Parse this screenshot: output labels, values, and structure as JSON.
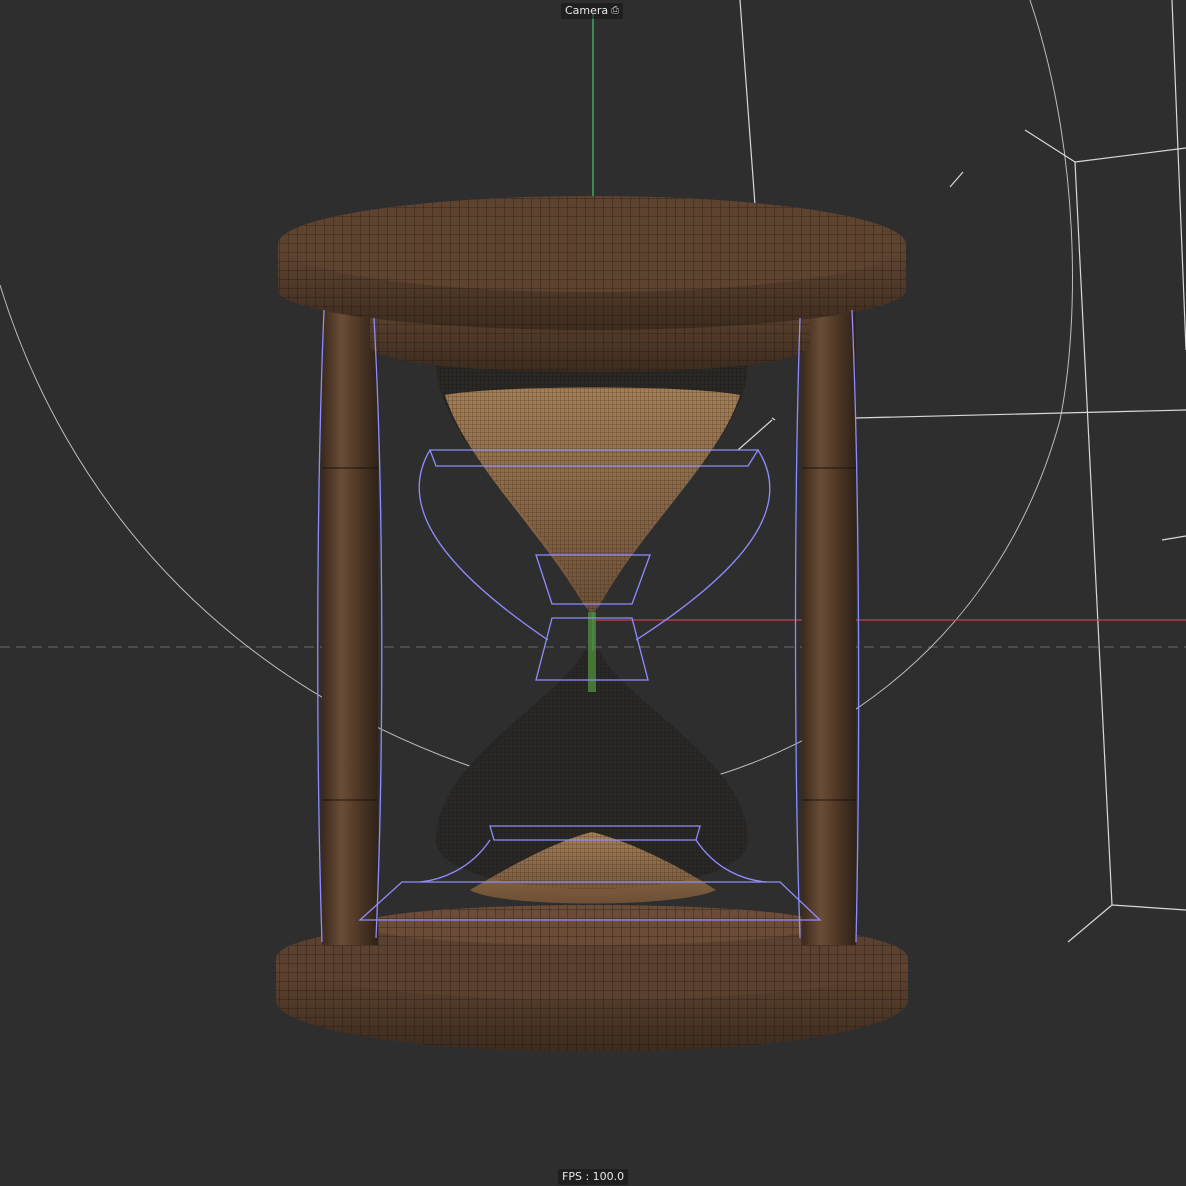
{
  "viewport": {
    "camera_label": "Camera",
    "camera_icon": "camera-icon",
    "fps_text": "FPS : 100.0"
  },
  "colors": {
    "background": "#2e2e2e",
    "axis_y": "#3fbf6a",
    "axis_x": "#c0434d",
    "selection_outline": "#8f8cff",
    "wood": "#5a4030",
    "wood_dark": "#3a2a1e",
    "sand": "#a07a52",
    "glass": "#2b2b2b",
    "light_gizmo": "#d8d8d8"
  }
}
